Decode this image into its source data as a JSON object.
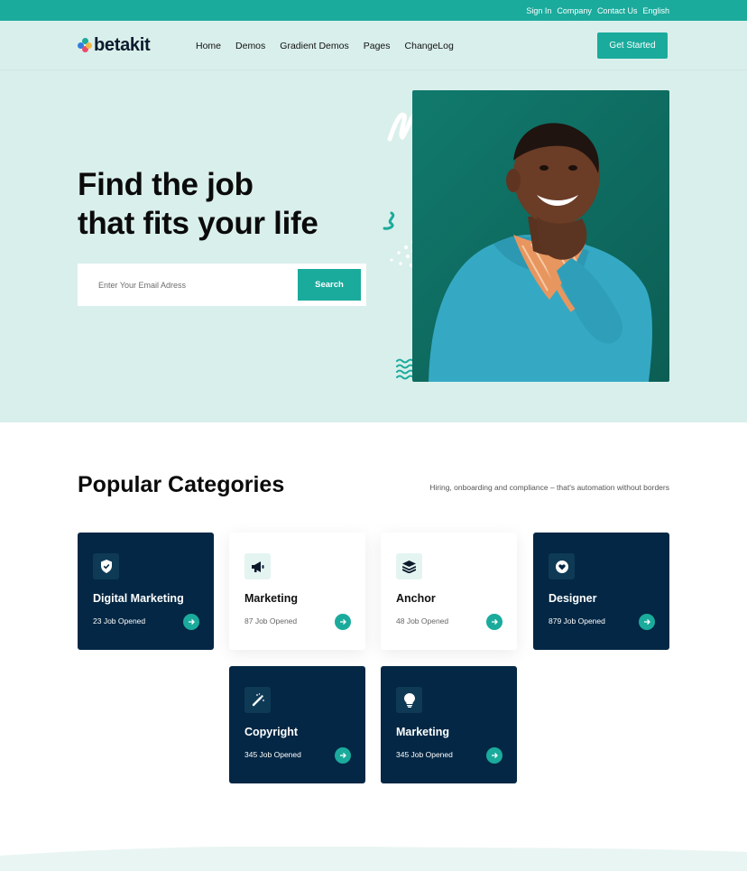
{
  "topbar": {
    "links": [
      "Sign In",
      "Company",
      "Contact Us",
      "English"
    ]
  },
  "brand": {
    "name": "betakit",
    "colors": {
      "accent": "#1aab9c",
      "navy": "#032744",
      "hero_bg": "#d9efeb"
    }
  },
  "nav": {
    "items": [
      "Home",
      "Demos",
      "Gradient Demos",
      "Pages",
      "ChangeLog"
    ],
    "cta": "Get Started"
  },
  "hero": {
    "title_line1": "Find the job",
    "title_line2": "that fits your life",
    "email_placeholder": "Enter Your Email Adress",
    "search_label": "Search"
  },
  "categories": {
    "title": "Popular Categories",
    "subtitle": "Hiring, onboarding and compliance – that's automation without borders",
    "cards": [
      {
        "title": "Digital Marketing",
        "count": "23 Job Opened",
        "icon": "shield-check-icon",
        "style": "dark"
      },
      {
        "title": "Marketing",
        "count": "87 Job Opened",
        "icon": "megaphone-icon",
        "style": "light"
      },
      {
        "title": "Anchor",
        "count": "48 Job Opened",
        "icon": "layers-icon",
        "style": "light"
      },
      {
        "title": "Designer",
        "count": "879 Job Opened",
        "icon": "heart-icon",
        "style": "dark"
      },
      {
        "title": "Copyright",
        "count": "345 Job Opened",
        "icon": "magic-wand-icon",
        "style": "dark"
      },
      {
        "title": "Marketing",
        "count": "345 Job Opened",
        "icon": "lightbulb-icon",
        "style": "dark"
      }
    ]
  }
}
